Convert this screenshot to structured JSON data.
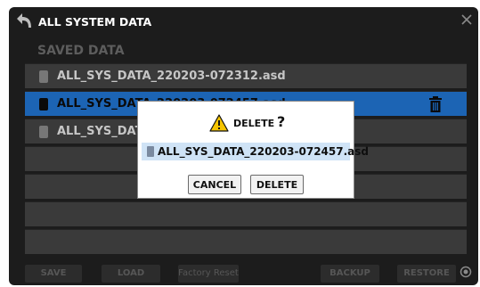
{
  "header": {
    "title": "ALL SYSTEM DATA"
  },
  "section": {
    "title": "SAVED DATA"
  },
  "files": [
    {
      "label": "ALL_SYS_DATA_220203-072312.asd"
    },
    {
      "label": "ALL_SYS_DATA_220203-072457.asd"
    },
    {
      "label": "ALL_SYS_DATA_220203-072635.asd"
    }
  ],
  "footer": {
    "save": "SAVE",
    "load": "LOAD",
    "factory_reset": "Factory Reset",
    "backup": "BACKUP",
    "restore": "RESTORE"
  },
  "dialog": {
    "title": "DELETE",
    "question": "?",
    "filename": "ALL_SYS_DATA_220203-072457.asd",
    "cancel": "CANCEL",
    "delete": "DELETE"
  },
  "colors": {
    "selected_row": "#1c64b4",
    "panel_bg": "#1c1c1c",
    "row_bg": "#3a3a3a"
  }
}
